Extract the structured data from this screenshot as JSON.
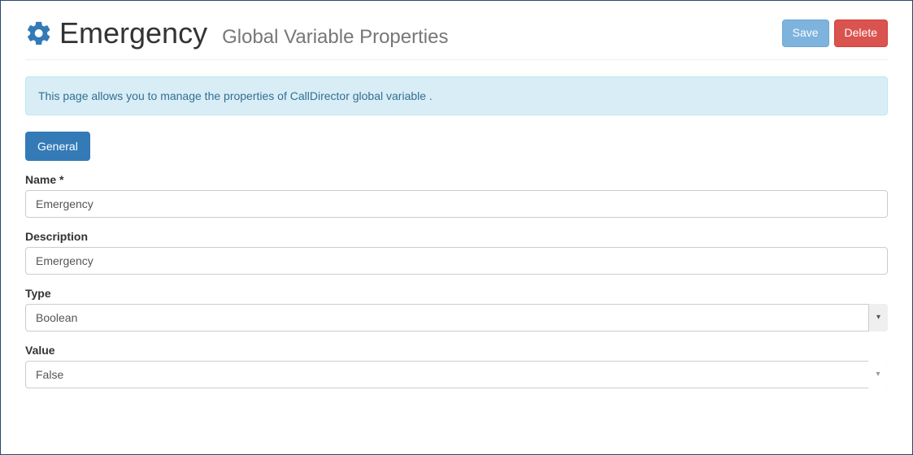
{
  "header": {
    "title": "Emergency",
    "subtitle": "Global Variable Properties",
    "save_label": "Save",
    "delete_label": "Delete"
  },
  "alert": {
    "text": "This page allows you to manage the properties of CallDirector global variable ."
  },
  "tabs": {
    "general": "General"
  },
  "form": {
    "name_label": "Name *",
    "name_value": "Emergency",
    "description_label": "Description",
    "description_value": "Emergency",
    "type_label": "Type",
    "type_value": "Boolean",
    "value_label": "Value",
    "value_value": "False"
  }
}
